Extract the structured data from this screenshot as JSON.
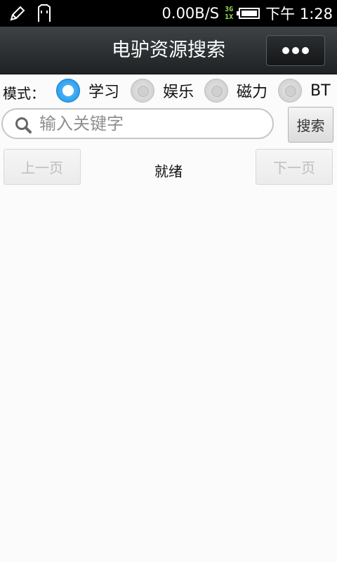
{
  "status_bar": {
    "speed": "0.00B/S",
    "network_top": "3G",
    "network_bottom": "1X",
    "time": "下午 1:28"
  },
  "title_bar": {
    "title": "电驴资源搜索"
  },
  "mode": {
    "label": "模式：",
    "options": [
      {
        "label": "学习",
        "checked": true
      },
      {
        "label": "娱乐",
        "checked": false
      },
      {
        "label": "磁力",
        "checked": false
      },
      {
        "label": "BT",
        "checked": false
      }
    ]
  },
  "search": {
    "placeholder": "输入关键字",
    "value": "",
    "button_label": "搜索"
  },
  "paging": {
    "prev_label": "上一页",
    "next_label": "下一页",
    "status": "就绪"
  },
  "colors": {
    "accent": "#1a8fe3",
    "titlebar": "#2c2f31"
  }
}
